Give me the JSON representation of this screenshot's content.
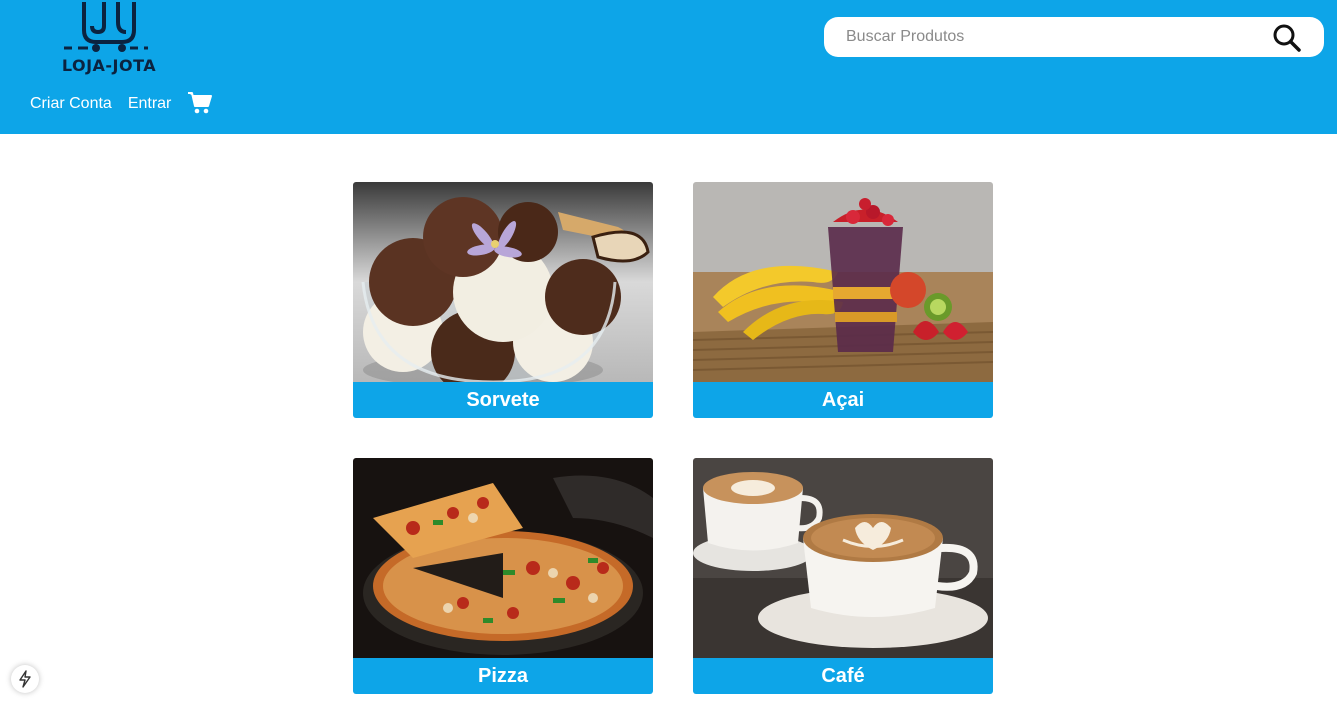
{
  "brand": {
    "name": "LOJA-JOTA",
    "logo_icon": "shopping-cart-logo-icon"
  },
  "nav": {
    "create_account": "Criar Conta",
    "login": "Entrar",
    "cart_icon": "shopping-cart-icon"
  },
  "search": {
    "placeholder": "Buscar Produtos",
    "value": "",
    "icon": "search-icon"
  },
  "products": [
    {
      "label": "Sorvete",
      "image": "ice-cream-photo"
    },
    {
      "label": "Açai",
      "image": "acai-photo"
    },
    {
      "label": "Pizza",
      "image": "pizza-photo"
    },
    {
      "label": "Café",
      "image": "coffee-photo"
    }
  ],
  "colors": {
    "header": "#0da5e8",
    "card_label": "#0da5e8",
    "logo_ink": "#0b2340"
  },
  "floating_button_icon": "lightning-icon"
}
